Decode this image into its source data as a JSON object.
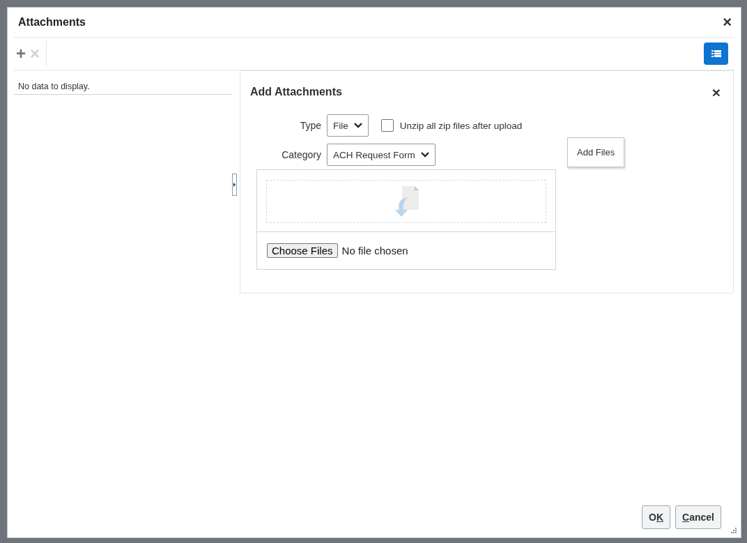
{
  "window": {
    "title": "Attachments",
    "close": "×"
  },
  "toolbar": {
    "add": "+",
    "remove": "×",
    "add_disabled": false,
    "remove_disabled": true
  },
  "list": {
    "empty_text": "No data to display."
  },
  "panel": {
    "title": "Add Attachments",
    "close": "×",
    "type": {
      "label": "Type",
      "value": "File"
    },
    "unzip": {
      "label": "Unzip all zip files after upload",
      "checked": false
    },
    "category": {
      "label": "Category",
      "value": "ACH Request Form"
    },
    "tooltip": "Add Files",
    "choose_button": "Choose Files",
    "file_status": "No file chosen"
  },
  "buttons": [
    {
      "label": [
        {
          "text": "O",
          "underlined": false
        },
        {
          "text": "K",
          "underlined": true
        }
      ]
    },
    {
      "label": [
        {
          "text": "C",
          "underlined": true
        },
        {
          "text": "ancel",
          "underlined": false
        }
      ]
    }
  ]
}
